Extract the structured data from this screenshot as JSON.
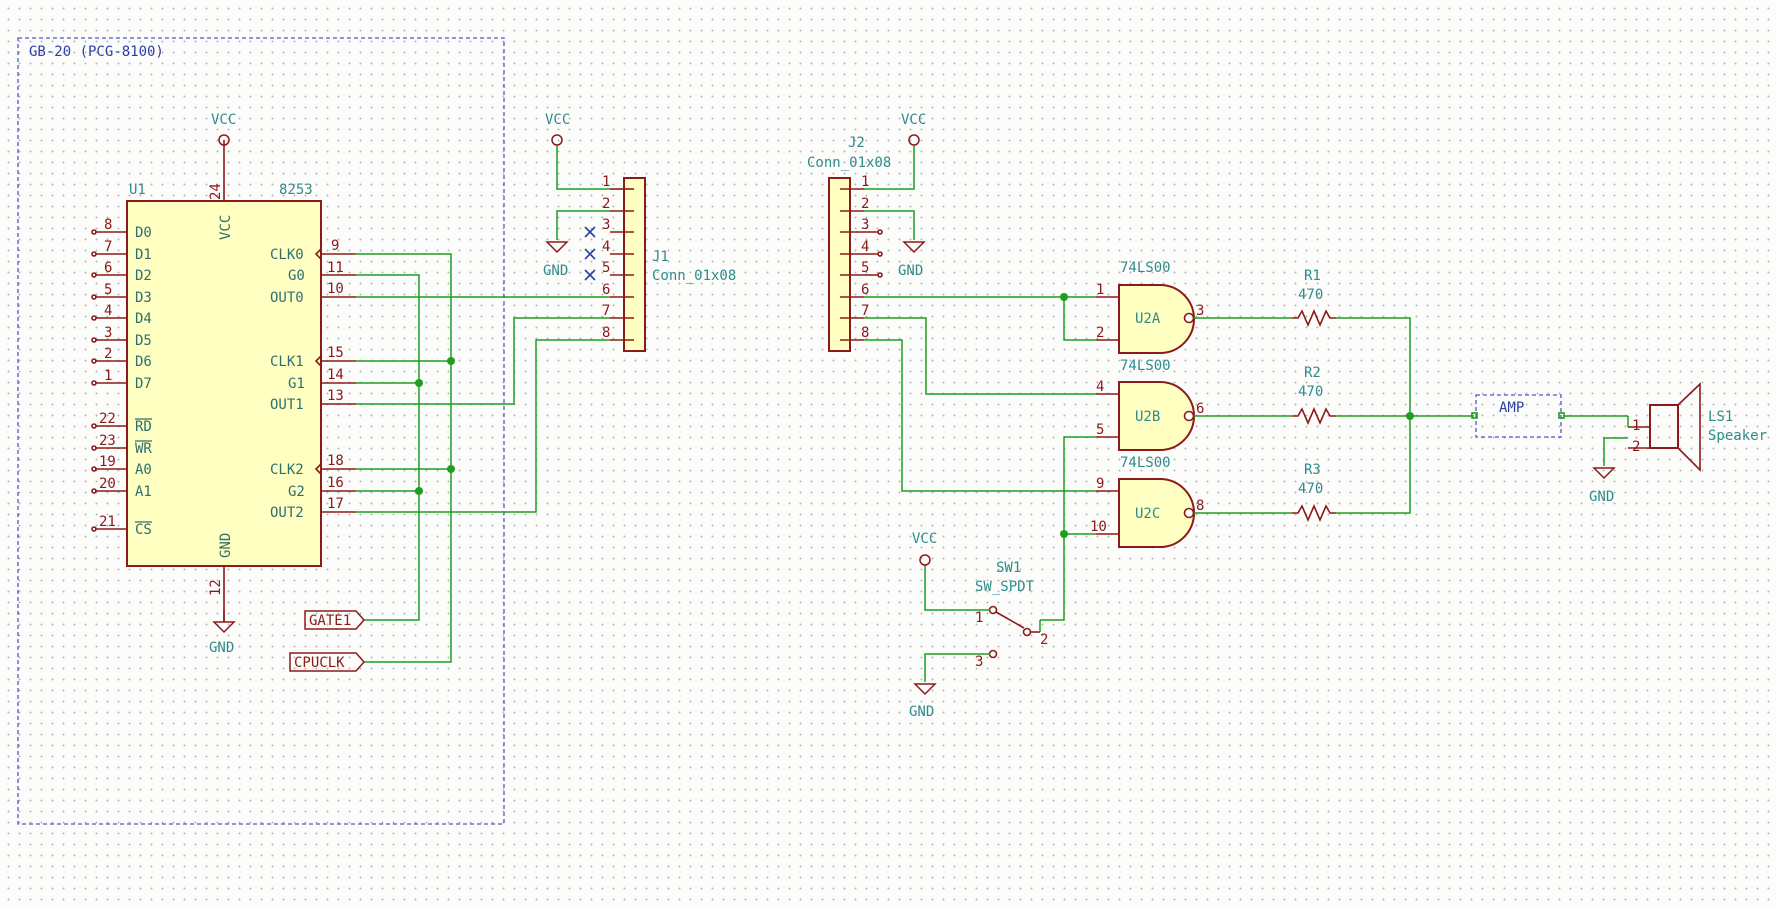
{
  "sheet": {
    "frame_title": "GB-20 (PCG-8100)"
  },
  "power": {
    "vcc": "VCC",
    "gnd": "GND"
  },
  "u1": {
    "ref": "U1",
    "value": "8253",
    "top_pin": "VCC",
    "top_pin_num": "24",
    "bottom_pin": "GND",
    "bottom_pin_num": "12",
    "left_pins": [
      {
        "num": "8",
        "name": "D0"
      },
      {
        "num": "7",
        "name": "D1"
      },
      {
        "num": "6",
        "name": "D2"
      },
      {
        "num": "5",
        "name": "D3"
      },
      {
        "num": "4",
        "name": "D4"
      },
      {
        "num": "3",
        "name": "D5"
      },
      {
        "num": "2",
        "name": "D6"
      },
      {
        "num": "1",
        "name": "D7"
      },
      {
        "num": "22",
        "name": "RD"
      },
      {
        "num": "23",
        "name": "WR"
      },
      {
        "num": "19",
        "name": "A0"
      },
      {
        "num": "20",
        "name": "A1"
      },
      {
        "num": "21",
        "name": "CS"
      }
    ],
    "right_pins": [
      {
        "num": "9",
        "name": "CLK0"
      },
      {
        "num": "11",
        "name": "G0"
      },
      {
        "num": "10",
        "name": "OUT0"
      },
      {
        "num": "15",
        "name": "CLK1"
      },
      {
        "num": "14",
        "name": "G1"
      },
      {
        "num": "13",
        "name": "OUT1"
      },
      {
        "num": "18",
        "name": "CLK2"
      },
      {
        "num": "16",
        "name": "G2"
      },
      {
        "num": "17",
        "name": "OUT2"
      }
    ]
  },
  "labels": {
    "gate1": "GATE1",
    "cpuclk": "CPUCLK"
  },
  "j1": {
    "ref": "J1",
    "value": "Conn_01x08",
    "pins": [
      "1",
      "2",
      "3",
      "4",
      "5",
      "6",
      "7",
      "8"
    ]
  },
  "j2": {
    "ref": "J2",
    "value": "Conn_01x08",
    "pins": [
      "1",
      "2",
      "3",
      "4",
      "5",
      "6",
      "7",
      "8"
    ]
  },
  "gates": [
    {
      "ref": "U2A",
      "value": "74LS00",
      "in1": "1",
      "in2": "2",
      "out": "3"
    },
    {
      "ref": "U2B",
      "value": "74LS00",
      "in1": "4",
      "in2": "5",
      "out": "6"
    },
    {
      "ref": "U2C",
      "value": "74LS00",
      "in1": "9",
      "in2": "10",
      "out": "8"
    }
  ],
  "resistors": [
    {
      "ref": "R1",
      "value": "470"
    },
    {
      "ref": "R2",
      "value": "470"
    },
    {
      "ref": "R3",
      "value": "470"
    }
  ],
  "sw1": {
    "ref": "SW1",
    "value": "SW_SPDT",
    "p1": "1",
    "p2": "2",
    "p3": "3"
  },
  "amp": {
    "label": "AMP"
  },
  "ls1": {
    "ref": "LS1",
    "value": "Speaker",
    "p1": "1",
    "p2": "2"
  },
  "colors": {
    "wire": "#1f9e1f",
    "symbol": "#8b1a1a",
    "fill": "#ffffc2",
    "text": "#2f8c8c",
    "sheet_frame": "#5555c8"
  }
}
